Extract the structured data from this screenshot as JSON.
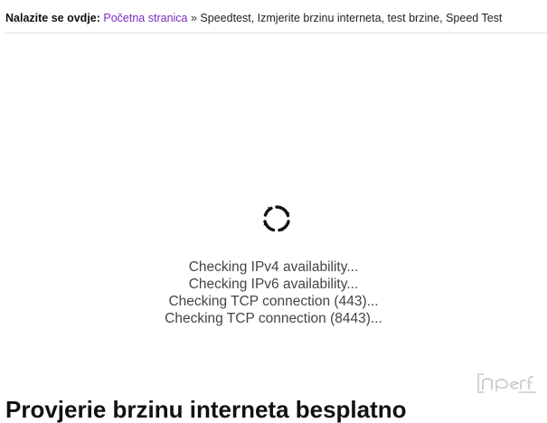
{
  "breadcrumb": {
    "lead": "Nalazite se ovdje:",
    "home": "Početna stranica",
    "separator": "»",
    "current": "Speedtest, Izmjerite brzinu interneta, test brzine, Speed Test"
  },
  "speedtest": {
    "status_lines": [
      "Checking IPv4 availability...",
      "Checking IPv6 availability...",
      "Checking TCP connection (443)...",
      "Checking TCP connection (8443)..."
    ],
    "loading_icon": "spinner-icon",
    "brand": "nperf"
  },
  "headline": "Provjerie brzinu interneta besplatno"
}
